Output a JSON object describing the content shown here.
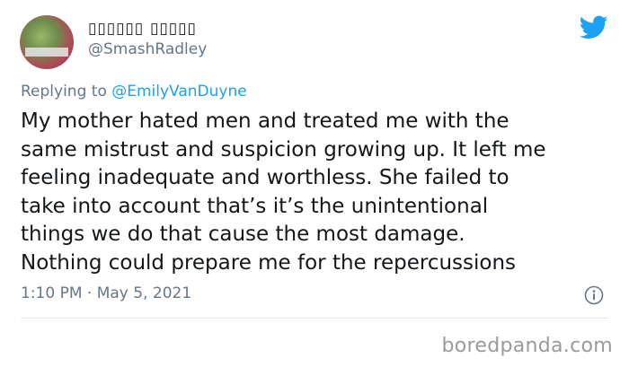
{
  "tweet": {
    "author": {
      "display_name": "▯▯▯▯▯▯ ▯▯▯▯▯",
      "handle": "@SmashRadley",
      "avatar_icon": "profile-avatar"
    },
    "reply_prefix": "Replying to",
    "reply_to": "@EmilyVanDuyne",
    "body_lines": [
      "My mother hated men and treated me with the",
      "same mistrust and suspicion growing up. It left me",
      "feeling inadequate and worthless. She failed to",
      "take into account that’s it’s the unintentional",
      "things we do that cause the most damage.",
      "Nothing could prepare me for the repercussions"
    ],
    "timestamp": "1:10 PM · May 5, 2021",
    "icons": {
      "brand": "twitter-bird-icon",
      "info": "info-icon"
    },
    "colors": {
      "brand": "#1da1f2",
      "muted": "#657786",
      "text": "#14171a"
    }
  },
  "watermark": "boredpanda.com"
}
